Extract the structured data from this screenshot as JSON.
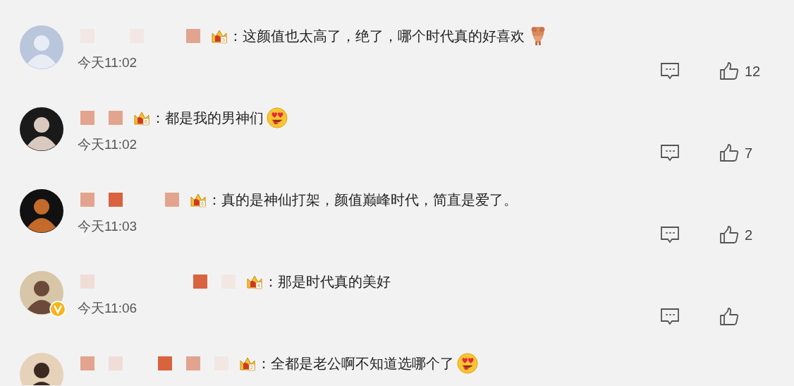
{
  "comments": [
    {
      "badge": "3",
      "text": "：这颜值也太高了，绝了，哪个时代真的好喜欢",
      "emoji": {
        "kind": "brown_figure"
      },
      "time": "今天11:02",
      "likes": "12",
      "verified": false
    },
    {
      "badge": "6",
      "text": "：都是我的男神们",
      "emoji": {
        "kind": "heart_eyes"
      },
      "time": "今天11:02",
      "likes": "7",
      "verified": false
    },
    {
      "badge": "6",
      "text": "：真的是神仙打架，颜值巅峰时代，简直是爱了。",
      "time": "今天11:03",
      "likes": "2",
      "verified": false
    },
    {
      "badge": "4",
      "text": "：那是时代真的美好",
      "time": "今天11:06",
      "verified": true
    },
    {
      "badge": "2",
      "text": "：全都是老公啊不知道选哪个了",
      "emoji": {
        "kind": "heart_eyes"
      },
      "verified": false
    }
  ]
}
